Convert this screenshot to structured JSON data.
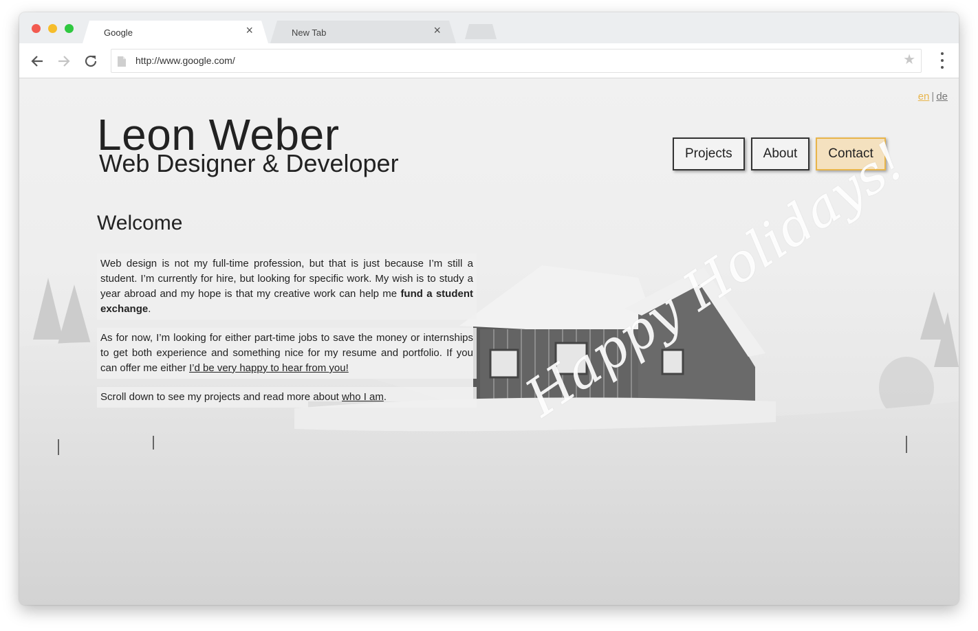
{
  "browser": {
    "tabs": [
      {
        "title": "Google",
        "close": "×"
      },
      {
        "title": "New Tab",
        "close": "×"
      }
    ],
    "url": "http://www.google.com/"
  },
  "page": {
    "lang": {
      "en": "en",
      "separator": "|",
      "de": "de"
    },
    "name": "Leon Weber",
    "subtitle": "Web Designer & Developer",
    "nav": {
      "projects": "Projects",
      "about": "About",
      "contact": "Contact"
    },
    "welcome": "Welcome",
    "p1": {
      "text": "Web design is not my full-time profession, but that is just because I’m still a student. I’m currently for hire, but looking for specific work. My wish is to study a year abroad and my hope is that my creative work can help me ",
      "bold": "fund a student exchange",
      "end": "."
    },
    "p2": {
      "text": "As for now, I’m looking for either part-time jobs to save the money or internships to get both experience and something nice for my resume and portfolio. If you can offer me either ",
      "link": "I’d be very happy to hear from you!"
    },
    "p3": {
      "text": "Scroll down to see my projects and read more about ",
      "link": "who I am",
      "end": "."
    },
    "overlay": "Happy Holidays!"
  },
  "colors": {
    "accent": "#e8b54b",
    "accent_bg": "#f4e1bf"
  }
}
